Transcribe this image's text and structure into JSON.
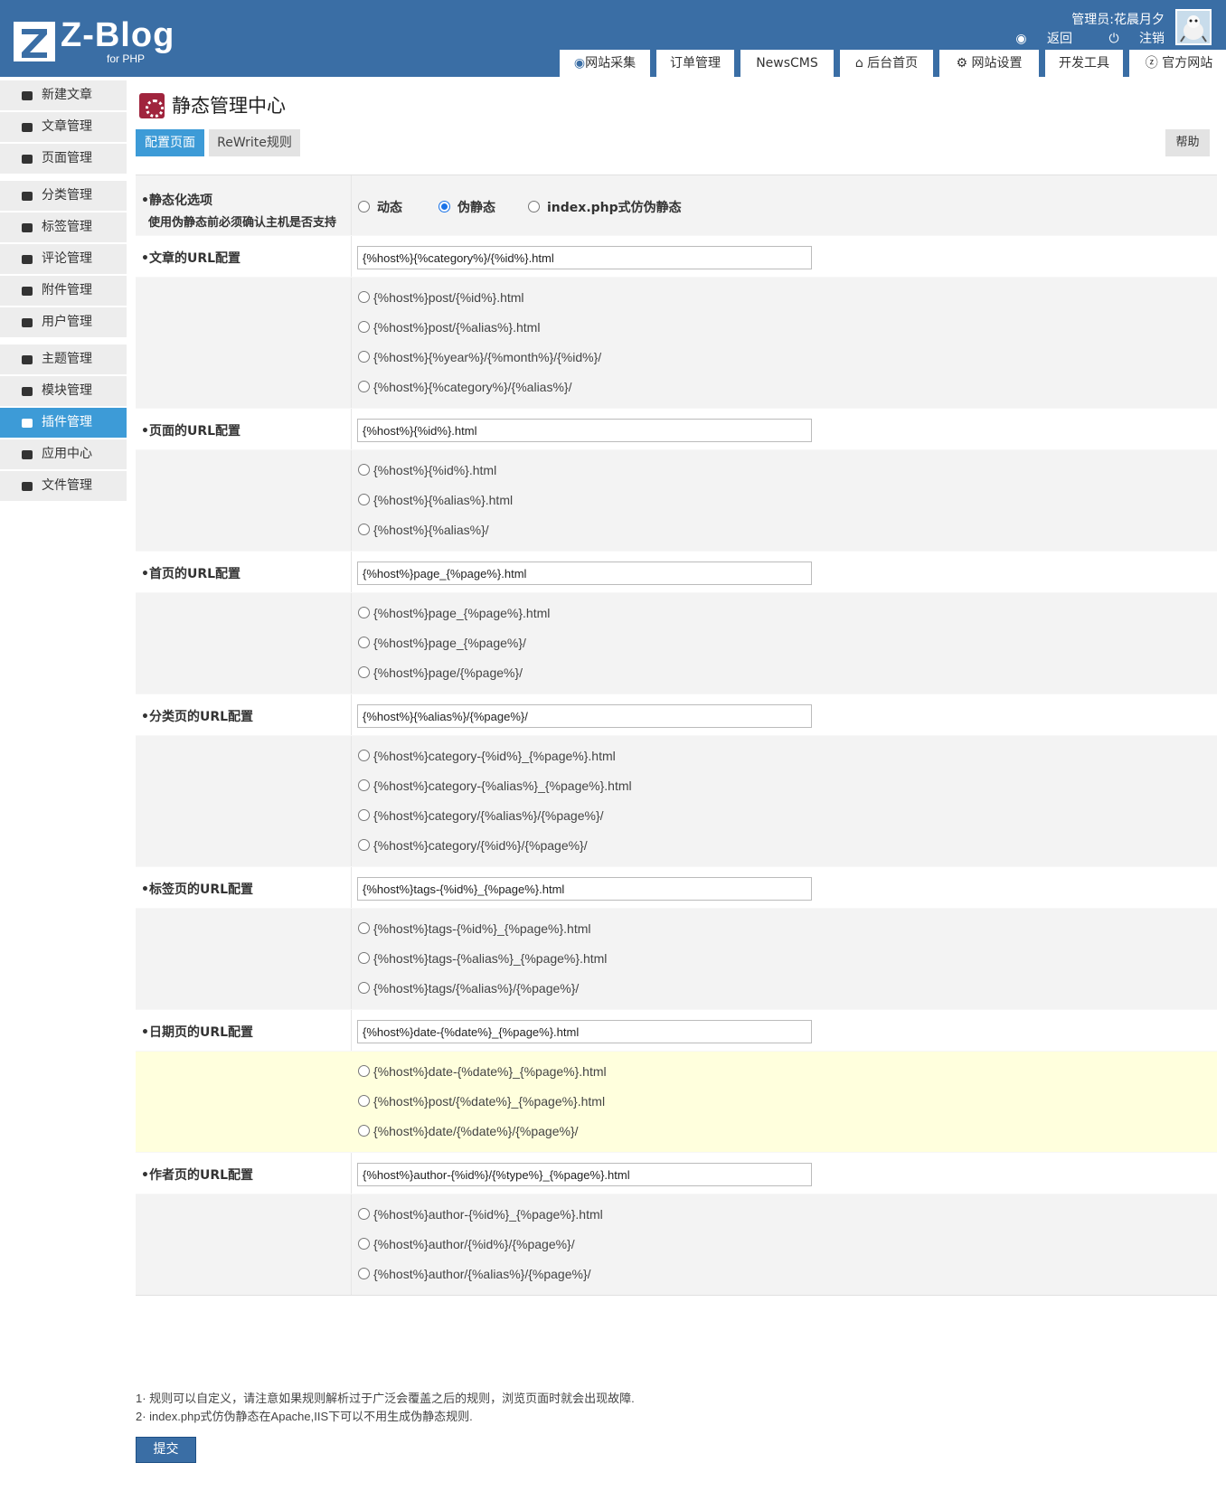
{
  "header": {
    "logo_text": "Z-Blog",
    "logo_sub": "for PHP",
    "admin_label": "管理员:",
    "admin_name": "花晨月夕",
    "back_label": "返回",
    "logout_label": "注销"
  },
  "topmenu": [
    {
      "label": "网站采集",
      "icon": "globe-icon"
    },
    {
      "label": "订单管理",
      "icon": ""
    },
    {
      "label": "NewsCMS",
      "icon": ""
    },
    {
      "label": "后台首页",
      "icon": "home-icon"
    },
    {
      "label": "网站设置",
      "icon": "gear-icon"
    },
    {
      "label": "开发工具",
      "icon": ""
    },
    {
      "label": "官方网站",
      "icon": "z-icon"
    }
  ],
  "sidebar": {
    "items": [
      {
        "label": "新建文章",
        "icon": "edit-icon"
      },
      {
        "label": "文章管理",
        "icon": "article-icon"
      },
      {
        "label": "页面管理",
        "icon": "page-icon"
      },
      {
        "label": "分类管理",
        "icon": "folder-icon"
      },
      {
        "label": "标签管理",
        "icon": "tag-icon"
      },
      {
        "label": "评论管理",
        "icon": "comment-icon"
      },
      {
        "label": "附件管理",
        "icon": "attachment-icon"
      },
      {
        "label": "用户管理",
        "icon": "users-icon"
      },
      {
        "label": "主题管理",
        "icon": "theme-icon"
      },
      {
        "label": "模块管理",
        "icon": "grid-icon"
      },
      {
        "label": "插件管理",
        "icon": "puzzle-icon"
      },
      {
        "label": "应用中心",
        "icon": "app-icon"
      },
      {
        "label": "文件管理",
        "icon": "file-icon"
      }
    ],
    "active_index": 10,
    "active_color": "#3d9bd7"
  },
  "main": {
    "title": "静态管理中心",
    "tabs": [
      "配置页面",
      "ReWrite规则"
    ],
    "help_label": "帮助",
    "static_option": {
      "label": "•静态化选项",
      "sublabel": "使用伪静态前必须确认主机是否支持",
      "choices": [
        "动态",
        "伪静态",
        "index.php式仿伪静态"
      ],
      "selected": "伪静态"
    },
    "sections": [
      {
        "label": "•文章的URL配置",
        "value": "{%host%}{%category%}/{%id%}.html",
        "options": [
          "{%host%}post/{%id%}.html",
          "{%host%}post/{%alias%}.html",
          "{%host%}{%year%}/{%month%}/{%id%}/",
          "{%host%}{%category%}/{%alias%}/"
        ]
      },
      {
        "label": "•页面的URL配置",
        "value": "{%host%}{%id%}.html",
        "options": [
          "{%host%}{%id%}.html",
          "{%host%}{%alias%}.html",
          "{%host%}{%alias%}/"
        ]
      },
      {
        "label": "•首页的URL配置",
        "value": "{%host%}page_{%page%}.html",
        "options": [
          "{%host%}page_{%page%}.html",
          "{%host%}page_{%page%}/",
          "{%host%}page/{%page%}/"
        ]
      },
      {
        "label": "•分类页的URL配置",
        "value": "{%host%}{%alias%}/{%page%}/",
        "options": [
          "{%host%}category-{%id%}_{%page%}.html",
          "{%host%}category-{%alias%}_{%page%}.html",
          "{%host%}category/{%alias%}/{%page%}/",
          "{%host%}category/{%id%}/{%page%}/"
        ]
      },
      {
        "label": "•标签页的URL配置",
        "value": "{%host%}tags-{%id%}_{%page%}.html",
        "options": [
          "{%host%}tags-{%id%}_{%page%}.html",
          "{%host%}tags-{%alias%}_{%page%}.html",
          "{%host%}tags/{%alias%}/{%page%}/"
        ]
      },
      {
        "label": "•日期页的URL配置",
        "value": "{%host%}date-{%date%}_{%page%}.html",
        "options": [
          "{%host%}date-{%date%}_{%page%}.html",
          "{%host%}post/{%date%}_{%page%}.html",
          "{%host%}date/{%date%}/{%page%}/"
        ]
      },
      {
        "label": "•作者页的URL配置",
        "value": "{%host%}author-{%id%}/{%type%}_{%page%}.html",
        "options": [
          "{%host%}author-{%id%}_{%page%}.html",
          "{%host%}author/{%id%}/{%page%}/",
          "{%host%}author/{%alias%}/{%page%}/"
        ]
      }
    ],
    "notes": [
      "1· 规则可以自定义，请注意如果规则解析过于广泛会覆盖之后的规则，浏览页面时就会出现故障.",
      "2· index.php式仿伪静态在Apache,IIS下可以不用生成伪静态规则."
    ],
    "submit_label": "提交"
  },
  "colors": {
    "header_bg": "#3a6ea5",
    "accent": "#3d9bd7",
    "highlight_row": "#ffffdd"
  }
}
